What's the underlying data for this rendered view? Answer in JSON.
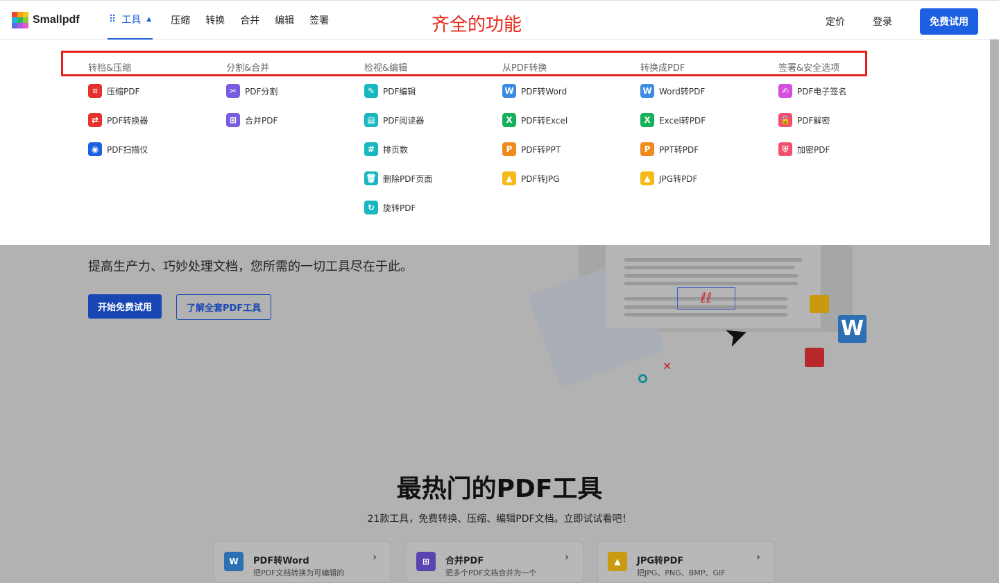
{
  "header": {
    "brand": "Smallpdf",
    "tools": "工具",
    "nav": [
      "压缩",
      "转换",
      "合并",
      "编辑",
      "签署"
    ],
    "annotation": "齐全的功能",
    "pricing": "定价",
    "login": "登录",
    "trial": "免费试用"
  },
  "menu": {
    "columns": [
      {
        "title": "转档&压缩",
        "items": [
          {
            "label": "压缩PDF",
            "color": "#e5322d",
            "glyph": "⌗"
          },
          {
            "label": "PDF转换器",
            "color": "#e5322d",
            "glyph": "⇄"
          },
          {
            "label": "PDF扫描仪",
            "color": "#1c5fe0",
            "glyph": "◉"
          }
        ]
      },
      {
        "title": "分割&合并",
        "items": [
          {
            "label": "PDF分割",
            "color": "#7a5ce0",
            "glyph": "✂"
          },
          {
            "label": "合并PDF",
            "color": "#7a5ce0",
            "glyph": "⊞"
          }
        ]
      },
      {
        "title": "检视&编辑",
        "items": [
          {
            "label": "PDF编辑",
            "color": "#19b8c0",
            "glyph": "✎"
          },
          {
            "label": "PDF阅读器",
            "color": "#19b8c0",
            "glyph": "▤"
          },
          {
            "label": "排页数",
            "color": "#19b8c0",
            "glyph": "#"
          },
          {
            "label": "删除PDF页面",
            "color": "#19b8c0",
            "glyph": "🗑"
          },
          {
            "label": "旋转PDF",
            "color": "#19b8c0",
            "glyph": "↻"
          }
        ]
      },
      {
        "title": "从PDF转换",
        "items": [
          {
            "label": "PDF转Word",
            "color": "#3b8be0",
            "glyph": "W"
          },
          {
            "label": "PDF转Excel",
            "color": "#14b05a",
            "glyph": "X"
          },
          {
            "label": "PDF转PPT",
            "color": "#f08a1c",
            "glyph": "P"
          },
          {
            "label": "PDF转JPG",
            "color": "#f5b918",
            "glyph": "▲"
          }
        ]
      },
      {
        "title": "转换成PDF",
        "items": [
          {
            "label": "Word转PDF",
            "color": "#3b8be0",
            "glyph": "W"
          },
          {
            "label": "Excel转PDF",
            "color": "#14b05a",
            "glyph": "X"
          },
          {
            "label": "PPT转PDF",
            "color": "#f08a1c",
            "glyph": "P"
          },
          {
            "label": "JPG转PDF",
            "color": "#f5b918",
            "glyph": "▲"
          }
        ]
      },
      {
        "title": "签署&安全选项",
        "items": [
          {
            "label": "PDF电子签名",
            "color": "#d64ee0",
            "glyph": "✍"
          },
          {
            "label": "PDF解密",
            "color": "#f0506e",
            "glyph": "🔓"
          },
          {
            "label": "加密PDF",
            "color": "#f0506e",
            "glyph": "⛨"
          }
        ]
      }
    ]
  },
  "hero": {
    "tagline": "提高生产力、巧妙处理文档，您所需的一切工具尽在于此。",
    "primary": "开始免费试用",
    "secondary": "了解全套PDF工具"
  },
  "popular": {
    "title": "最热门的PDF工具",
    "subtitle": "21款工具，免费转换、压缩、编辑PDF文档。立即试试看吧！",
    "cards": [
      {
        "title": "PDF转Word",
        "desc": "把PDF文档转换为可编辑的",
        "color": "#2d6fb3",
        "glyph": "W"
      },
      {
        "title": "合并PDF",
        "desc": "把多个PDF文档合并为一个",
        "color": "#5a44b0",
        "glyph": "⊞"
      },
      {
        "title": "JPG转PDF",
        "desc": "把JPG、PNG、BMP、GIF",
        "color": "#c99a10",
        "glyph": "▲"
      }
    ]
  }
}
